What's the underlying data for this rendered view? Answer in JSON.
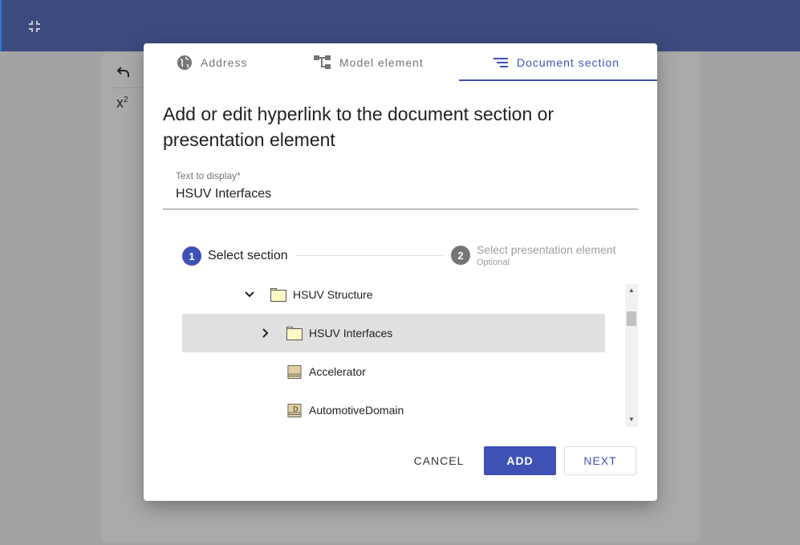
{
  "background": {
    "toolbar_icons": [
      "undo-icon",
      "superscript-icon"
    ]
  },
  "dialog": {
    "tabs": [
      {
        "label": "Address",
        "icon": "globe-icon"
      },
      {
        "label": "Model element",
        "icon": "hierarchy-icon"
      },
      {
        "label": "Document section",
        "icon": "sort-lines-icon",
        "active": true
      }
    ],
    "title": "Add or edit hyperlink to the document section or presentation element",
    "text_field": {
      "label": "Text to display*",
      "value": "HSUV Interfaces"
    },
    "steps": [
      {
        "number": "1",
        "label": "Select section",
        "active": true
      },
      {
        "number": "2",
        "label": "Select presentation element",
        "sublabel": "Optional"
      }
    ],
    "tree": [
      {
        "label": "HSUV Structure",
        "icon": "folder-icon",
        "expanded": true
      },
      {
        "label": "HSUV Interfaces",
        "icon": "folder-icon",
        "expanded": false,
        "selected": true
      },
      {
        "label": "Accelerator",
        "icon": "block-icon"
      },
      {
        "label": "AutomotiveDomain",
        "icon": "domain-block-icon"
      }
    ],
    "buttons": {
      "cancel": "CANCEL",
      "add": "ADD",
      "next": "NEXT"
    }
  },
  "colors": {
    "primary": "#3f51b5",
    "header": "#3d4a80"
  }
}
